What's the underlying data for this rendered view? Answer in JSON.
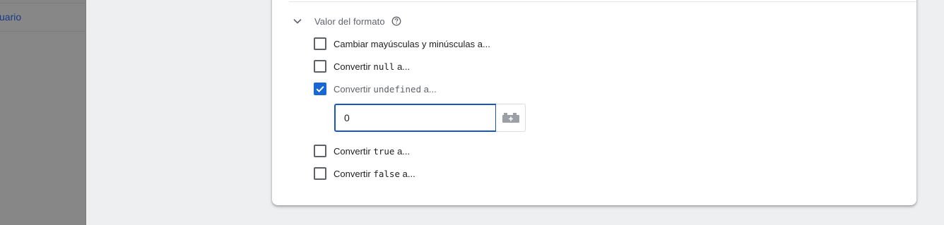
{
  "sidebar": {
    "item_label": "uario"
  },
  "section": {
    "title": "Valor del formato"
  },
  "options": [
    {
      "prefix": "Cambiar mayúsculas y minúsculas a...",
      "code": "",
      "suffix": "",
      "checked": false
    },
    {
      "prefix": "Convertir ",
      "code": "null",
      "suffix": " a...",
      "checked": false
    },
    {
      "prefix": "Convertir ",
      "code": "undefined",
      "suffix": " a...",
      "checked": true
    },
    {
      "prefix": "Convertir ",
      "code": "true",
      "suffix": " a...",
      "checked": false
    },
    {
      "prefix": "Convertir ",
      "code": "false",
      "suffix": " a...",
      "checked": false
    }
  ],
  "undefined_input": {
    "value": "0"
  },
  "icons": {
    "section_toggle": "chevron-down-icon",
    "help": "help-circle-icon",
    "variable_picker": "variable-brick-icon",
    "checkbox_checked": "check-icon"
  },
  "colors": {
    "accent": "#1967d2",
    "input_border": "#1a57c6",
    "sidebar_link": "#163a86",
    "sidebar_bg": "#878787",
    "page_bg": "#eeeff1"
  }
}
